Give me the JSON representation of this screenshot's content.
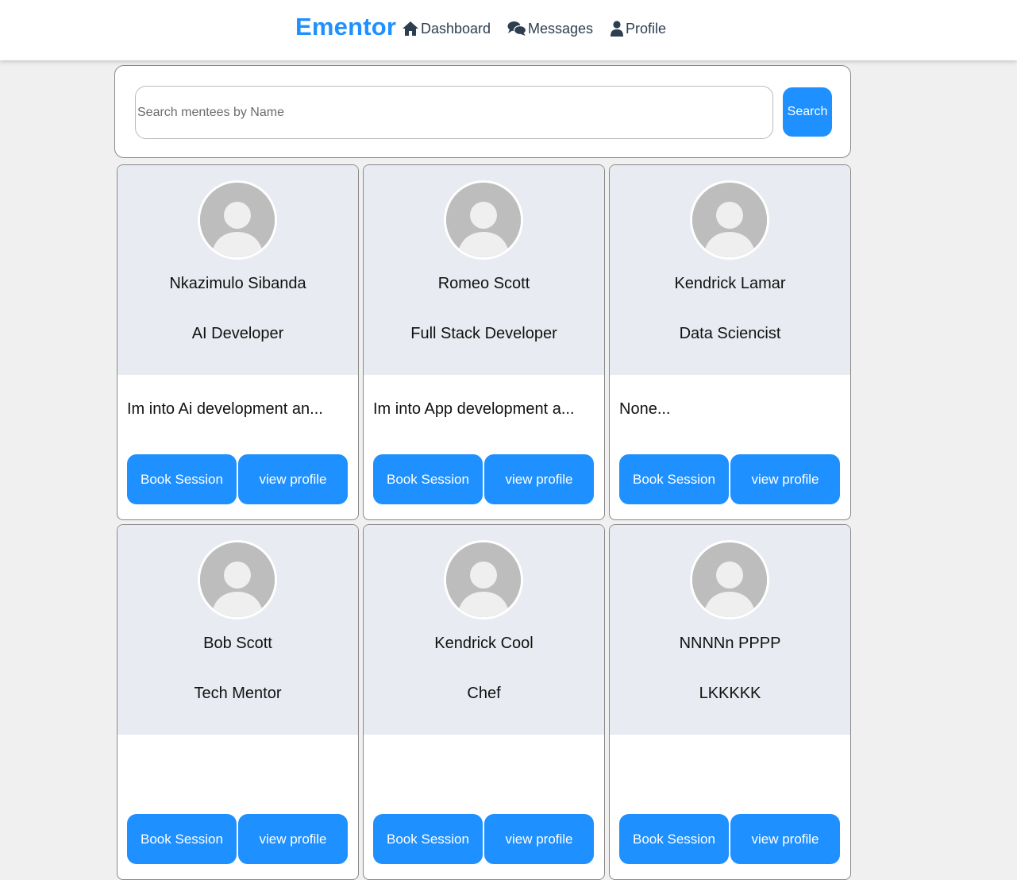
{
  "brand": "Ementor",
  "nav": {
    "dashboard": {
      "label": "Dashboard",
      "icon": "home-icon"
    },
    "messages": {
      "label": "Messages",
      "icon": "comments-icon"
    },
    "profile": {
      "label": "Profile",
      "icon": "user-icon"
    }
  },
  "search": {
    "placeholder": "Search mentees by Name",
    "value": "",
    "button_label": "Search"
  },
  "colors": {
    "accent": "#1e90ff",
    "card_header_bg": "#e8ebf1",
    "page_bg": "#f0f0f0"
  },
  "cards": [
    {
      "name": "Nkazimulo Sibanda",
      "role": "AI Developer",
      "bio": "Im into Ai development an...",
      "book_label": "Book Session",
      "view_label": "view profile"
    },
    {
      "name": "Romeo Scott",
      "role": "Full Stack Developer",
      "bio": "Im into App development a...",
      "book_label": "Book Session",
      "view_label": "view profile"
    },
    {
      "name": "Kendrick Lamar",
      "role": "Data Sciencist",
      "bio": "None...",
      "book_label": "Book Session",
      "view_label": "view profile"
    },
    {
      "name": "Bob Scott",
      "role": "Tech Mentor",
      "bio": "",
      "book_label": "Book Session",
      "view_label": "view profile"
    },
    {
      "name": "Kendrick Cool",
      "role": "Chef",
      "bio": "",
      "book_label": "Book Session",
      "view_label": "view profile"
    },
    {
      "name": "NNNNn PPPP",
      "role": "LKKKKK",
      "bio": "",
      "book_label": "Book Session",
      "view_label": "view profile"
    }
  ]
}
